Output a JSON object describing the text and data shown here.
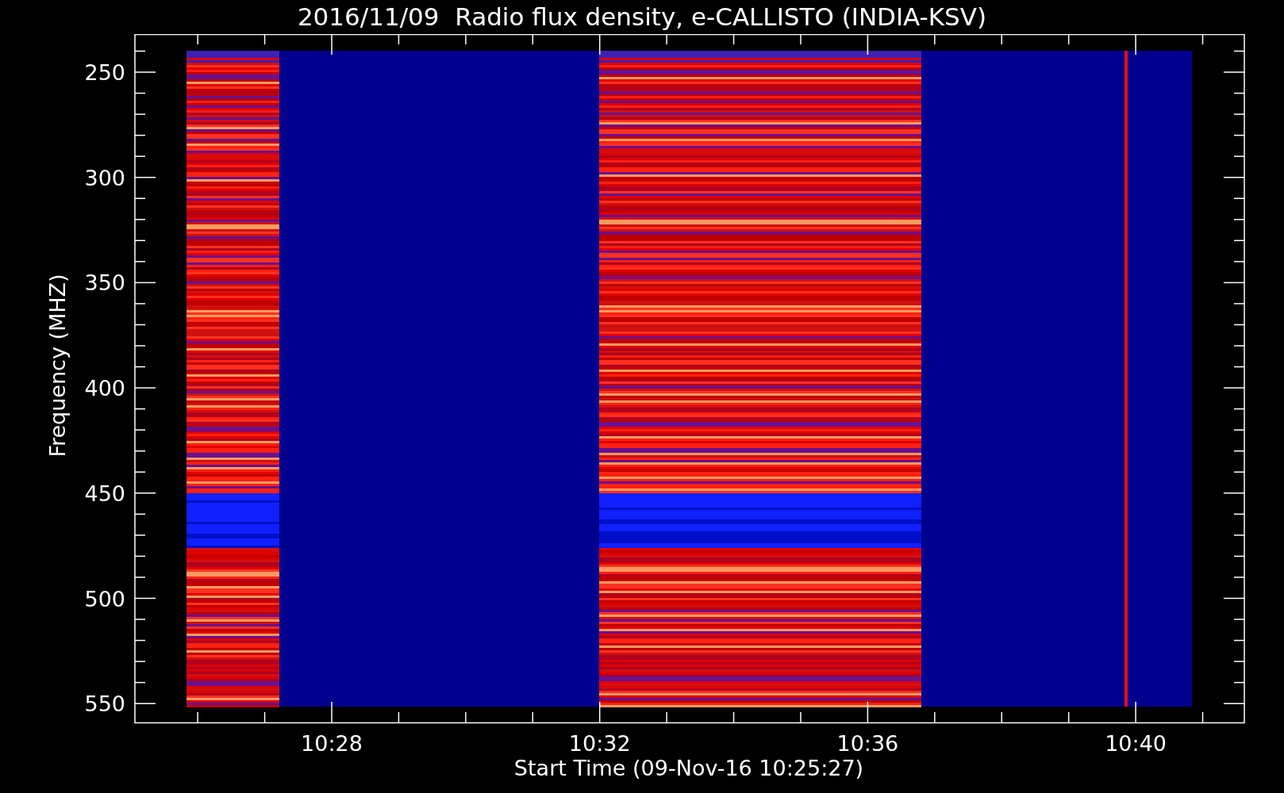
{
  "title": "2016/11/09  Radio flux density, e-CALLISTO (INDIA-KSV)",
  "y_axis": {
    "label": "Frequency (MHZ)",
    "ticks": [
      "250",
      "300",
      "350",
      "400",
      "450",
      "500",
      "550"
    ]
  },
  "x_axis": {
    "label": "Start Time (09-Nov-16 10:25:27)",
    "ticks": [
      "10:28",
      "10:32",
      "10:36",
      "10:40"
    ]
  }
}
